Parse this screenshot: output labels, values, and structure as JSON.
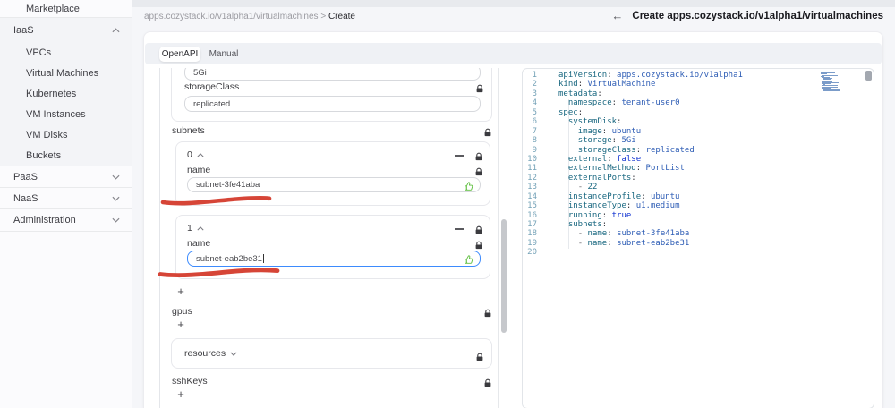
{
  "sidebar": {
    "top_item": "Marketplace",
    "groups": [
      {
        "label": "IaaS",
        "expanded": true,
        "items": [
          "VPCs",
          "Virtual Machines",
          "Kubernetes",
          "VM Instances",
          "VM Disks",
          "Buckets"
        ]
      },
      {
        "label": "PaaS",
        "expanded": false,
        "items": []
      },
      {
        "label": "NaaS",
        "expanded": false,
        "items": []
      },
      {
        "label": "Administration",
        "expanded": false,
        "items": []
      }
    ]
  },
  "breadcrumb": {
    "path": "apps.cozystack.io/v1alpha1/virtualmachines",
    "separator": ">",
    "current": "Create"
  },
  "page_header": {
    "back_icon": "←",
    "title": "Create apps.cozystack.io/v1alpha1/virtualmachines"
  },
  "tabs": {
    "openapi": "OpenAPI",
    "manual": "Manual"
  },
  "form": {
    "storage": {
      "value": "5Gi"
    },
    "storage_class": {
      "label": "storageClass",
      "value": "replicated"
    },
    "subnets": {
      "label": "subnets",
      "items": [
        {
          "index": "0",
          "field_label": "name",
          "value": "subnet-3fe41aba",
          "focused": false
        },
        {
          "index": "1",
          "field_label": "name",
          "value": "subnet-eab2be31",
          "focused": true
        }
      ],
      "add_label": "+"
    },
    "gpus": {
      "label": "gpus",
      "add_label": "+"
    },
    "resources": {
      "label": "resources"
    },
    "ssh_keys": {
      "label": "sshKeys",
      "add_label": "+"
    }
  },
  "editor": {
    "lines": [
      {
        "n": "1",
        "segs": [
          [
            "apiVersion",
            "k"
          ],
          [
            ": ",
            "p"
          ],
          [
            "apps.cozystack.io/v1alpha1",
            "v"
          ]
        ]
      },
      {
        "n": "2",
        "segs": [
          [
            "kind",
            "k"
          ],
          [
            ": ",
            "p"
          ],
          [
            "VirtualMachine",
            "v"
          ]
        ]
      },
      {
        "n": "3",
        "segs": [
          [
            "metadata",
            "k"
          ],
          [
            ":",
            "p"
          ]
        ]
      },
      {
        "n": "4",
        "segs": [
          [
            "  ",
            "w"
          ],
          [
            "namespace",
            "k"
          ],
          [
            ": ",
            "p"
          ],
          [
            "tenant-user0",
            "v"
          ]
        ]
      },
      {
        "n": "5",
        "segs": [
          [
            "spec",
            "k"
          ],
          [
            ":",
            "p"
          ]
        ]
      },
      {
        "n": "6",
        "segs": [
          [
            "  ",
            "w"
          ],
          [
            "systemDisk",
            "k"
          ],
          [
            ":",
            "p"
          ]
        ]
      },
      {
        "n": "7",
        "segs": [
          [
            "    ",
            "w"
          ],
          [
            "image",
            "k"
          ],
          [
            ": ",
            "p"
          ],
          [
            "ubuntu",
            "v"
          ]
        ]
      },
      {
        "n": "8",
        "segs": [
          [
            "    ",
            "w"
          ],
          [
            "storage",
            "k"
          ],
          [
            ": ",
            "p"
          ],
          [
            "5Gi",
            "v"
          ]
        ]
      },
      {
        "n": "9",
        "segs": [
          [
            "    ",
            "w"
          ],
          [
            "storageClass",
            "k"
          ],
          [
            ": ",
            "p"
          ],
          [
            "replicated",
            "v"
          ]
        ]
      },
      {
        "n": "10",
        "segs": [
          [
            "  ",
            "w"
          ],
          [
            "external",
            "k"
          ],
          [
            ": ",
            "p"
          ],
          [
            "false",
            "b"
          ]
        ]
      },
      {
        "n": "11",
        "segs": [
          [
            "  ",
            "w"
          ],
          [
            "externalMethod",
            "k"
          ],
          [
            ": ",
            "p"
          ],
          [
            "PortList",
            "v"
          ]
        ]
      },
      {
        "n": "12",
        "segs": [
          [
            "  ",
            "w"
          ],
          [
            "externalPorts",
            "k"
          ],
          [
            ":",
            "p"
          ]
        ]
      },
      {
        "n": "13",
        "segs": [
          [
            "    ",
            "w"
          ],
          [
            "- ",
            "d"
          ],
          [
            "22",
            "num"
          ]
        ]
      },
      {
        "n": "14",
        "segs": [
          [
            "  ",
            "w"
          ],
          [
            "instanceProfile",
            "k"
          ],
          [
            ": ",
            "p"
          ],
          [
            "ubuntu",
            "v"
          ]
        ]
      },
      {
        "n": "15",
        "segs": [
          [
            "  ",
            "w"
          ],
          [
            "instanceType",
            "k"
          ],
          [
            ": ",
            "p"
          ],
          [
            "u1.medium",
            "v"
          ]
        ]
      },
      {
        "n": "16",
        "segs": [
          [
            "  ",
            "w"
          ],
          [
            "running",
            "k"
          ],
          [
            ": ",
            "p"
          ],
          [
            "true",
            "b"
          ]
        ]
      },
      {
        "n": "17",
        "segs": [
          [
            "  ",
            "w"
          ],
          [
            "subnets",
            "k"
          ],
          [
            ":",
            "p"
          ]
        ]
      },
      {
        "n": "18",
        "segs": [
          [
            "    ",
            "w"
          ],
          [
            "- ",
            "d"
          ],
          [
            "name",
            "k"
          ],
          [
            ": ",
            "p"
          ],
          [
            "subnet-3fe41aba",
            "v"
          ]
        ]
      },
      {
        "n": "19",
        "segs": [
          [
            "    ",
            "w"
          ],
          [
            "- ",
            "d"
          ],
          [
            "name",
            "k"
          ],
          [
            ": ",
            "p"
          ],
          [
            "subnet-eab2be31",
            "v"
          ]
        ]
      },
      {
        "n": "20",
        "segs": []
      }
    ]
  },
  "colors": {
    "accent_blue": "#3d8bfd",
    "annotation_red": "#d43b2c",
    "thumb_green": "#5fbf3f",
    "yaml_key": "#17667f",
    "yaml_value": "#2e5db5",
    "yaml_bool": "#0d2fd0"
  }
}
